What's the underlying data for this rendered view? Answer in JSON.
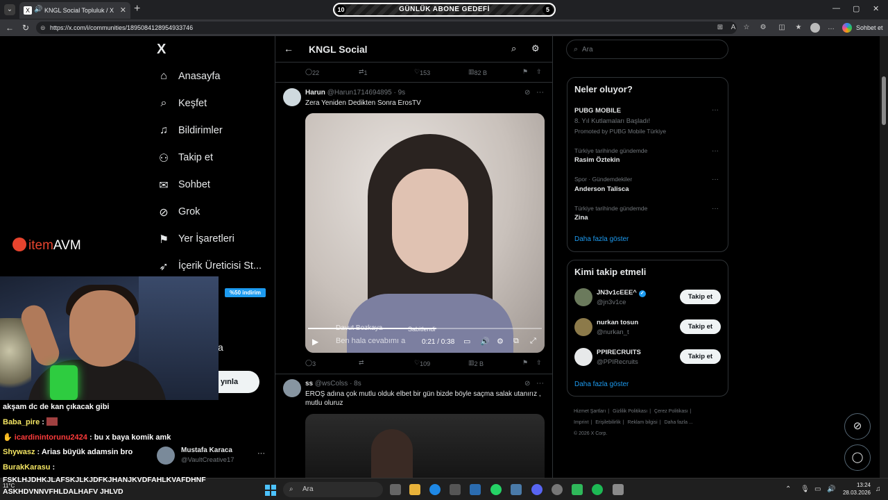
{
  "browser": {
    "tab_title": "KNGL Social Topluluk / X",
    "tab_icon_letter": "X",
    "url": "https://x.com/i/communities/1895084128954933746",
    "copilot_label": "Sohbet et"
  },
  "goal_bar": {
    "left_count": "10",
    "title": "GÜNLÜK ABONE GEDEFİ",
    "right_count": "5"
  },
  "sidenav": {
    "logo": "X",
    "items": [
      {
        "label": "Anasayfa",
        "icon": "home-icon"
      },
      {
        "label": "Keşfet",
        "icon": "search-icon"
      },
      {
        "label": "Bildirimler",
        "icon": "bell-icon"
      },
      {
        "label": "Takip et",
        "icon": "person-add-icon"
      },
      {
        "label": "Sohbet",
        "icon": "mail-icon"
      },
      {
        "label": "Grok",
        "icon": "grok-icon"
      },
      {
        "label": "Yer İşaretleri",
        "icon": "bookmark-icon"
      },
      {
        "label": "İçerik Üreticisi St...",
        "icon": "rocket-icon"
      }
    ],
    "partial_label": "a",
    "post_button": "yınla",
    "promo_badge": "%50 indirim",
    "account": {
      "name": "Mustafa Karaca",
      "handle": "@VaultCreative17"
    }
  },
  "column": {
    "title": "KNGL Social",
    "top_actions": {
      "replies": "22",
      "reposts": "1",
      "likes": "153",
      "views": "82 B"
    },
    "tweets": [
      {
        "name": "Harun",
        "handle": "@Harun1714694895 · 9s",
        "text": "Zera Yeniden Dedikten Sonra ErosTV",
        "video": {
          "overlay_name": "Davut Bozkaya",
          "overlay_pinned": "Sabitlendi",
          "overlay_text": "Ben hala cevabımı a",
          "time": "0:21 / 0:38",
          "progress": 0.55
        },
        "actions": {
          "replies": "3",
          "reposts": "",
          "likes": "109",
          "views": "2 B"
        }
      },
      {
        "name": "ss",
        "handle": "@wsColss · 8s",
        "text": "EROŞ adına çok mutlu olduk elbet bir gün bizde böyle saçma salak utanırız , mutlu oluruz"
      }
    ]
  },
  "right": {
    "search_placeholder": "Ara",
    "trends_title": "Neler oluyor?",
    "trends": [
      {
        "meta": "",
        "name": "PUBG MOBILE",
        "sub": "8. Yıl Kutlamaları Başladı!",
        "promo": "Promoted by PUBG Mobile Türkiye"
      },
      {
        "meta": "Türkiye tarihinde gündemde",
        "name": "Rasim Öztekin"
      },
      {
        "meta": "Spor · Gündemdekiler",
        "name": "Anderson Talisca"
      },
      {
        "meta": "Türkiye tarihinde gündemde",
        "name": "Zina"
      }
    ],
    "show_more": "Daha fazla göster",
    "who_title": "Kimi takip etmeli",
    "who": [
      {
        "name": "JN3v1cEEE^",
        "handle": "@jn3v1ce",
        "verified": true,
        "button": "Takip et"
      },
      {
        "name": "nurkan tosun",
        "handle": "@nurkan_t",
        "verified": false,
        "button": "Takip et"
      },
      {
        "name": "PPIRECRUITS",
        "handle": "@PPIRecruits",
        "verified": false,
        "button": "Takip et"
      }
    ],
    "who_show_more": "Daha fazla göster",
    "footer": [
      "Hizmet Şartları",
      "|",
      "Gizlilik Politikası",
      "|",
      "Çerez Politikası",
      "|",
      "Imprint",
      "|",
      "Erişilebilirlik",
      "|",
      "Reklam bilgisi",
      "|",
      "Daha fazla ...",
      "© 2026 X Corp."
    ]
  },
  "stream": {
    "sponsor_prefix": "item",
    "sponsor_suffix": "AVM",
    "chat": [
      {
        "user": "",
        "msg": "akşam dc de kan çıkacak gibi",
        "color": "#ffffff"
      },
      {
        "user": "Baba_pire",
        "msg": "",
        "color": "#f5e663",
        "emote": true
      },
      {
        "user": "icardinintorunu2424",
        "msg": ": bu x baya komik amk",
        "color": "#ff3b3b",
        "badge": true
      },
      {
        "user": "Shywasz",
        "msg": ": Arias büyük adamsin bro",
        "color": "#f5e663"
      },
      {
        "user": "BurakKarasu",
        "msg": ":",
        "color": "#f5e663"
      },
      {
        "user": "",
        "msg": "FSKLHJDHKJLAFSKJLKJDFKJHANJKVDFAHLKVAFDHNF",
        "color": "#ffffff"
      },
      {
        "user": "",
        "msg": "ASKHDVNNVFHLDALHAFV JHLVD",
        "color": "#ffffff"
      }
    ]
  },
  "taskbar": {
    "search_placeholder": "Ara",
    "weather": "11°C",
    "time": "13:24",
    "date": "28.03.2026"
  },
  "colors": {
    "accent": "#1d9bf0",
    "background": "#000000",
    "border": "#2f3336",
    "text_secondary": "#71767b"
  }
}
